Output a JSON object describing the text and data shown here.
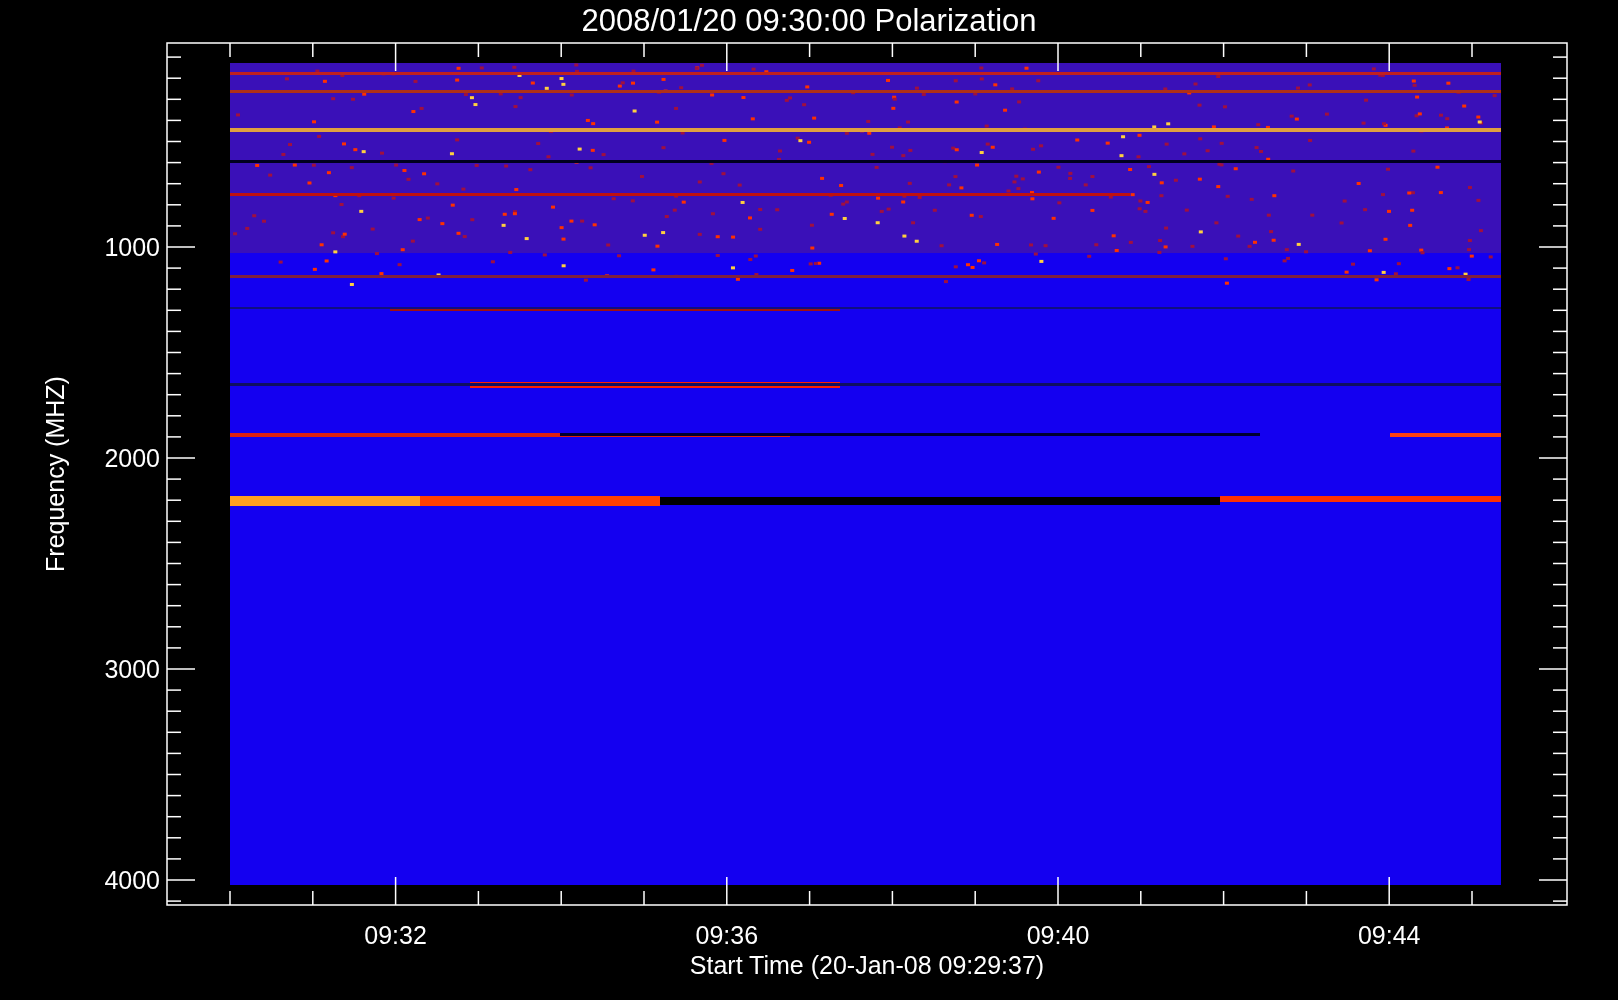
{
  "title": "2008/01/20 09:30:00 Polarization",
  "y_axis": {
    "label": "Frequency (MHZ)",
    "ticks": [
      "1000",
      "2000",
      "3000",
      "4000"
    ]
  },
  "x_axis": {
    "label": "Start Time (20-Jan-08 09:29:37)",
    "ticks": [
      "09:32",
      "09:36",
      "09:40",
      "09:44"
    ]
  }
}
